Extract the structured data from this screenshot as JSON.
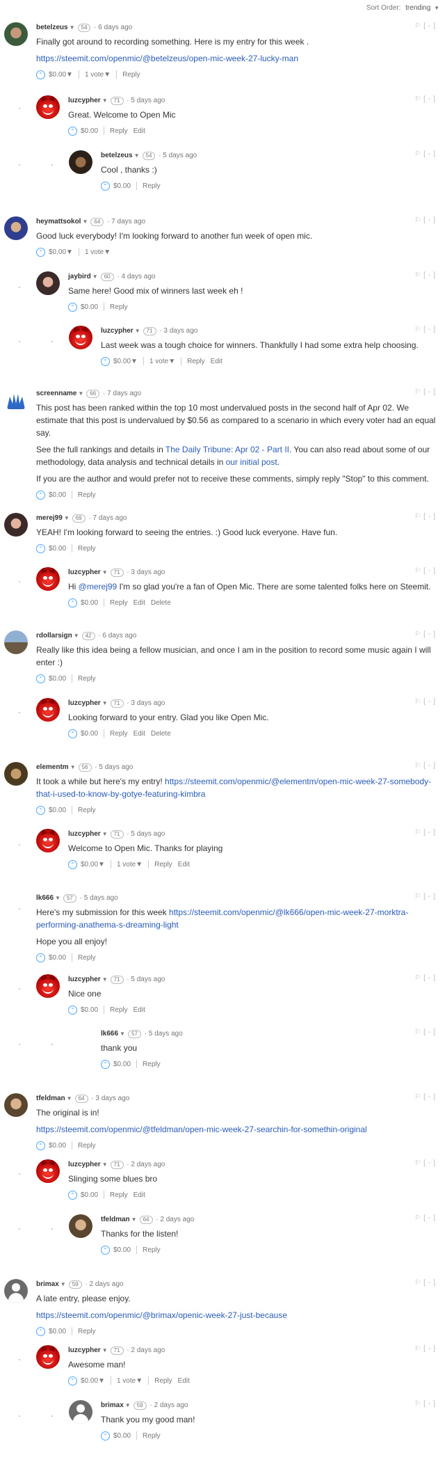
{
  "sort": {
    "label": "Sort Order:",
    "value": "trending"
  },
  "toggle_collapse": "[-]",
  "flag": "⚐",
  "comments": [
    {
      "author": "betelzeus",
      "rep": "54",
      "time": "6 days ago",
      "body": [
        "Finally got around to recording something. Here is my entry for this week ."
      ],
      "link": "https://steemit.com/openmic/@betelzeus/open-mic-week-27-lucky-man",
      "payout": "$0.00",
      "votes": "1 vote",
      "actions": [
        "Reply"
      ]
    },
    {
      "author": "luzcypher",
      "rep": "71",
      "time": "5 days ago",
      "body": [
        "Great. Welcome to Open Mic"
      ],
      "payout": "$0.00",
      "actions": [
        "Reply",
        "Edit"
      ]
    },
    {
      "author": "betelzeus",
      "rep": "54",
      "time": "5 days ago",
      "body": [
        "Cool , thanks :)"
      ],
      "payout": "$0.00",
      "actions": [
        "Reply"
      ]
    },
    {
      "author": "heymattsokol",
      "rep": "64",
      "time": "7 days ago",
      "body": [
        "Good luck everybody! I'm looking forward to another fun week of open mic."
      ],
      "payout": "$0.00",
      "votes": "1 vote",
      "actions": []
    },
    {
      "author": "jaybird",
      "rep": "60",
      "time": "4 days ago",
      "body": [
        "Same here! Good mix of winners last week eh !"
      ],
      "payout": "$0.00",
      "actions": [
        "Reply"
      ]
    },
    {
      "author": "luzcypher",
      "rep": "71",
      "time": "3 days ago",
      "body": [
        "Last week was a tough choice for winners. Thankfully I had some extra help choosing."
      ],
      "payout": "$0.00",
      "votes": "1 vote",
      "actions": [
        "Reply",
        "Edit"
      ]
    },
    {
      "author": "screenname",
      "rep": "66",
      "time": "7 days ago",
      "body": [
        "This post has been ranked within the top 10 most undervalued posts in the second half of Apr 02. We estimate that this post is undervalued by $0.56 as compared to a scenario in which every voter had an equal say.",
        "See the full rankings and details in The Daily Tribune: Apr 02 - Part II. You can also read about some of our methodology, data analysis and technical details in our initial post.",
        "If you are the author and would prefer not to receive these comments, simply reply \"Stop\" to this comment."
      ],
      "payout": "$0.00",
      "actions": [
        "Reply"
      ]
    },
    {
      "author": "merej99",
      "rep": "69",
      "time": "7 days ago",
      "body": [
        "YEAH! I'm looking forward to seeing the entries. :) Good luck everyone. Have fun."
      ],
      "payout": "$0.00",
      "actions": [
        "Reply"
      ]
    },
    {
      "author": "luzcypher",
      "rep": "71",
      "time": "3 days ago",
      "body": [
        "Hi @merej99 I'm so glad you're a fan of Open Mic. There are some talented folks here on Steemit."
      ],
      "payout": "$0.00",
      "actions": [
        "Reply",
        "Edit",
        "Delete"
      ]
    },
    {
      "author": "rdollarsign",
      "rep": "42",
      "time": "6 days ago",
      "body": [
        "Really like this idea being a fellow musician, and once I am in the position to record some music again I will enter :)"
      ],
      "payout": "$0.00",
      "actions": [
        "Reply"
      ]
    },
    {
      "author": "luzcypher",
      "rep": "71",
      "time": "3 days ago",
      "body": [
        "Looking forward to your entry. Glad you like Open Mic."
      ],
      "payout": "$0.00",
      "actions": [
        "Reply",
        "Edit",
        "Delete"
      ]
    },
    {
      "author": "elementm",
      "rep": "56",
      "time": "5 days ago",
      "body": [
        "It took a while but here's my entry! https://steemit.com/openmic/@elementm/open-mic-week-27-somebody-that-i-used-to-know-by-gotye-featuring-kimbra"
      ],
      "payout": "$0.00",
      "actions": [
        "Reply"
      ]
    },
    {
      "author": "luzcypher",
      "rep": "71",
      "time": "5 days ago",
      "body": [
        "Welcome to Open Mic. Thanks for playing"
      ],
      "payout": "$0.00",
      "votes": "1 vote",
      "actions": [
        "Reply",
        "Edit"
      ]
    },
    {
      "author": "lk666",
      "rep": "57",
      "time": "5 days ago",
      "body": [
        "Here's my submission for this week https://steemit.com/openmic/@lk666/open-mic-week-27-morktra-performing-anathema-s-dreaming-light",
        "Hope you all enjoy!"
      ],
      "payout": "$0.00",
      "actions": [
        "Reply"
      ]
    },
    {
      "author": "luzcypher",
      "rep": "71",
      "time": "5 days ago",
      "body": [
        "Nice one"
      ],
      "payout": "$0.00",
      "actions": [
        "Reply",
        "Edit"
      ]
    },
    {
      "author": "lk666",
      "rep": "57",
      "time": "5 days ago",
      "body": [
        "thank you"
      ],
      "payout": "$0.00",
      "actions": [
        "Reply"
      ]
    },
    {
      "author": "tfeldman",
      "rep": "64",
      "time": "3 days ago",
      "body": [
        "The original is in!"
      ],
      "link": "https://steemit.com/openmic/@tfeldman/open-mic-week-27-searchin-for-somethin-original",
      "payout": "$0.00",
      "actions": [
        "Reply"
      ]
    },
    {
      "author": "luzcypher",
      "rep": "71",
      "time": "2 days ago",
      "body": [
        "Slinging some blues bro"
      ],
      "payout": "$0.00",
      "actions": [
        "Reply",
        "Edit"
      ]
    },
    {
      "author": "tfeldman",
      "rep": "64",
      "time": "2 days ago",
      "body": [
        "Thanks for the listen!"
      ],
      "payout": "$0.00",
      "actions": [
        "Reply"
      ]
    },
    {
      "author": "brimax",
      "rep": "59",
      "time": "2 days ago",
      "body": [
        "A late entry, please enjoy."
      ],
      "link": "https://steemit.com/openmic/@brimax/openic-week-27-just-because",
      "payout": "$0.00",
      "actions": [
        "Reply"
      ]
    },
    {
      "author": "luzcypher",
      "rep": "71",
      "time": "2 days ago",
      "body": [
        "Awesome man!"
      ],
      "payout": "$0.00",
      "votes": "1 vote",
      "actions": [
        "Reply",
        "Edit"
      ]
    },
    {
      "author": "brimax",
      "rep": "59",
      "time": "2 days ago",
      "body": [
        "Thank you my good man!"
      ],
      "payout": "$0.00",
      "actions": [
        "Reply"
      ]
    }
  ]
}
